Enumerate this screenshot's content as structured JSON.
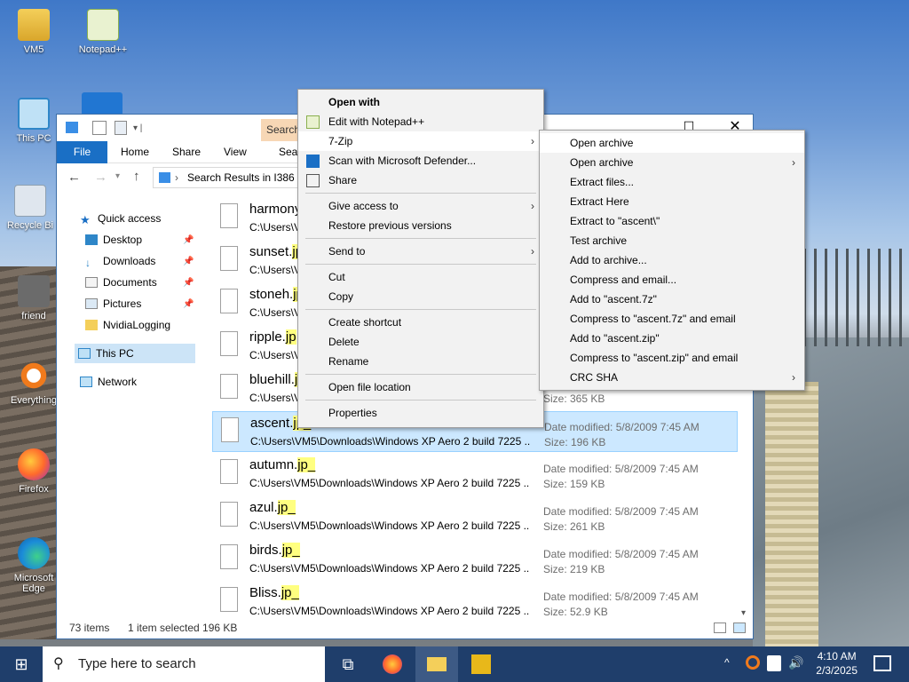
{
  "desktop": {
    "icons": [
      {
        "label": "VM5"
      },
      {
        "label": "Notepad++"
      },
      {
        "label": "This PC"
      },
      {
        "label": "Recycle Bi"
      },
      {
        "label": "friend"
      },
      {
        "label": "Everything"
      },
      {
        "label": "Firefox"
      },
      {
        "label": "Microsoft Edge"
      }
    ]
  },
  "explorer": {
    "search_tab": "Search",
    "ribbon_tabs": [
      "File",
      "Home",
      "Share",
      "View",
      "Sear"
    ],
    "address": "Search Results in I386",
    "nav": {
      "quick_access": "Quick access",
      "items": [
        "Desktop",
        "Downloads",
        "Documents",
        "Pictures",
        "NvidiaLogging"
      ],
      "this_pc": "This PC",
      "network": "Network"
    },
    "files": [
      {
        "name": "harmony",
        "ext": "",
        "path": "C:\\Users\\V",
        "mod": "",
        "size": ""
      },
      {
        "name": "sunset.",
        "ext": "jp",
        "path": "C:\\Users\\V",
        "mod": "",
        "size": ""
      },
      {
        "name": "stoneh.",
        "ext": "jp",
        "path": "C:\\Users\\V",
        "mod": "",
        "size": ""
      },
      {
        "name": "ripple.",
        "ext": "jp",
        "path": "C:\\Users\\V",
        "mod": "",
        "size": ""
      },
      {
        "name": "bluehill.",
        "ext": "jp",
        "path": "C:\\Users\\V",
        "mod": "",
        "size": "Size: 365 KB"
      },
      {
        "name": "ascent.",
        "ext": "jp_",
        "path": "C:\\Users\\VM5\\Downloads\\Windows XP Aero 2 build 7225 ...",
        "mod": "Date modified: 5/8/2009 7:45 AM",
        "size": "Size: 196 KB"
      },
      {
        "name": "autumn.",
        "ext": "jp_",
        "path": "C:\\Users\\VM5\\Downloads\\Windows XP Aero 2 build 7225 ...",
        "mod": "Date modified: 5/8/2009 7:45 AM",
        "size": "Size: 159 KB"
      },
      {
        "name": "azul.",
        "ext": "jp_",
        "path": "C:\\Users\\VM5\\Downloads\\Windows XP Aero 2 build 7225 ...",
        "mod": "Date modified: 5/8/2009 7:45 AM",
        "size": "Size: 261 KB"
      },
      {
        "name": "birds.",
        "ext": "jp_",
        "path": "C:\\Users\\VM5\\Downloads\\Windows XP Aero 2 build 7225 ...",
        "mod": "Date modified: 5/8/2009 7:45 AM",
        "size": "Size: 219 KB"
      },
      {
        "name": "Bliss.",
        "ext": "jp_",
        "path": "C:\\Users\\VM5\\Downloads\\Windows XP Aero 2 build 7225 ...",
        "mod": "Date modified: 5/8/2009 7:45 AM",
        "size": "Size: 52.9 KB"
      }
    ],
    "status": {
      "count": "73 items",
      "selected": "1 item selected  196 KB"
    }
  },
  "context_menu": {
    "items": [
      {
        "label": "Open with",
        "bold": true
      },
      {
        "label": "Edit with Notepad++"
      },
      {
        "label": "7-Zip"
      },
      {
        "label": "Scan with Microsoft Defender..."
      },
      {
        "label": "Share"
      },
      {
        "label": "Give access to"
      },
      {
        "label": "Restore previous versions"
      },
      {
        "label": "Send to"
      },
      {
        "label": "Cut"
      },
      {
        "label": "Copy"
      },
      {
        "label": "Create shortcut"
      },
      {
        "label": "Delete"
      },
      {
        "label": "Rename"
      },
      {
        "label": "Open file location"
      },
      {
        "label": "Properties"
      }
    ]
  },
  "submenu": {
    "items": [
      "Open archive",
      "Open archive",
      "Extract files...",
      "Extract Here",
      "Extract to \"ascent\\\"",
      "Test archive",
      "Add to archive...",
      "Compress and email...",
      "Add to \"ascent.7z\"",
      "Compress to \"ascent.7z\" and email",
      "Add to \"ascent.zip\"",
      "Compress to \"ascent.zip\" and email",
      "CRC SHA"
    ]
  },
  "taskbar": {
    "search_placeholder": "Type here to search",
    "time": "4:10 AM",
    "date": "2/3/2025"
  },
  "colors": {
    "accent": "#1a6fc5",
    "selection": "#cce8ff",
    "taskbar": "#1f3e6b"
  }
}
